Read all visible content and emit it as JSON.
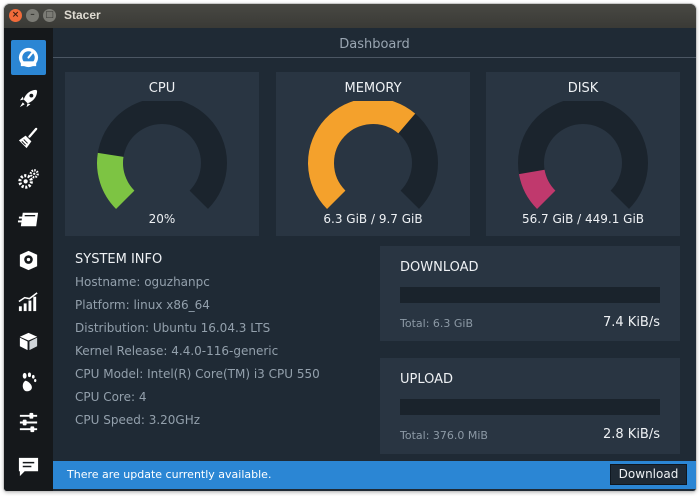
{
  "window": {
    "title": "Stacer"
  },
  "header": {
    "title": "Dashboard"
  },
  "sidebar": {
    "items": [
      {
        "icon": "dashboard-icon",
        "active": true
      },
      {
        "icon": "rocket-icon",
        "active": false
      },
      {
        "icon": "broom-icon",
        "active": false
      },
      {
        "icon": "gears-icon",
        "active": false
      },
      {
        "icon": "services-icon",
        "active": false
      },
      {
        "icon": "uninstaller-icon",
        "active": false
      },
      {
        "icon": "resources-icon",
        "active": false
      },
      {
        "icon": "package-icon",
        "active": false
      },
      {
        "icon": "gnome-foot-icon",
        "active": false
      },
      {
        "icon": "settings-sliders-icon",
        "active": false
      },
      {
        "icon": "feedback-icon",
        "active": false
      }
    ]
  },
  "gauges": {
    "cpu": {
      "title": "CPU",
      "value_text": "20%",
      "fraction": 0.2,
      "color": "#7dc443"
    },
    "memory": {
      "title": "MEMORY",
      "value_text": "6.3 GiB / 9.7 GiB",
      "fraction": 0.65,
      "color": "#f4a12c"
    },
    "disk": {
      "title": "DISK",
      "value_text": "56.7 GiB / 449.1 GiB",
      "fraction": 0.13,
      "color": "#c0396d"
    }
  },
  "system_info": {
    "title": "SYSTEM INFO",
    "lines": [
      "Hostname: oguzhanpc",
      "Platform: linux x86_64",
      "Distribution: Ubuntu 16.04.3 LTS",
      "Kernel Release: 4.4.0-116-generic",
      "CPU Model: Intel(R) Core(TM) i3 CPU 550",
      "CPU Core: 4",
      "CPU Speed: 3.20GHz"
    ]
  },
  "network": {
    "download": {
      "title": "DOWNLOAD",
      "total": "Total: 6.3 GiB",
      "speed": "7.4 KiB/s",
      "fraction": 0
    },
    "upload": {
      "title": "UPLOAD",
      "total": "Total: 376.0 MiB",
      "speed": "2.8 KiB/s",
      "fraction": 0
    }
  },
  "update_bar": {
    "message": "There are update currently available.",
    "button_label": "Download"
  },
  "colors": {
    "accent": "#2b86d4",
    "gauge_track": "#1b242d",
    "card_bg": "#293542",
    "window_bg": "#1f2a35"
  }
}
